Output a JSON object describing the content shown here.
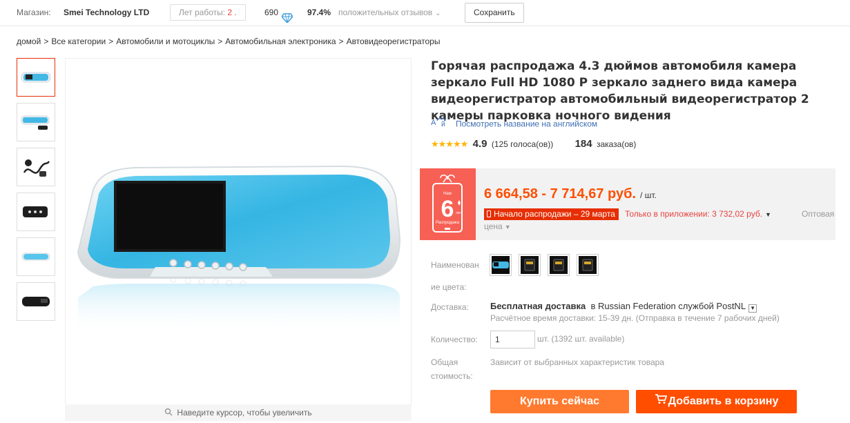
{
  "store": {
    "label": "Магазин:",
    "name": "Smei Technology LTD",
    "years_label": "Лет работы:",
    "years_value": "2 .",
    "score": "690",
    "positive_percent": "97.4%",
    "positive_label": "положительных отзывов",
    "save_label": "Сохранить"
  },
  "breadcrumb": [
    "домой",
    "Все категории",
    "Автомобили и мотоциклы",
    "Автомобильная электроника",
    "Автовидеорегистраторы"
  ],
  "gallery": {
    "thumb_count": 6,
    "zoom_hint": "Наведите курсор, чтобы увеличить"
  },
  "product": {
    "title": "Горячая распродажа 4.3 дюймов автомобиля камера зеркало Full HD 1080 P зеркало заднего вида камера видеорегистратор автомобильный видеорегистратор 2 камеры парковка ночного видения",
    "translate_link": "Посмотреть название на английском",
    "rating_value": "4.9",
    "rating_votes": "(125 голоса(ов))",
    "orders_count": "184",
    "orders_label": "заказа(ов)"
  },
  "promo": {
    "years_num": "6",
    "line1": "Нам",
    "line2": "лет",
    "line3": "Распродажа"
  },
  "pricing": {
    "price_range": "6 664,58 - 7 714,67 руб.",
    "unit": "/ шт.",
    "sale_start": "Начало распродажи – 29 марта",
    "app_only": "Только в приложении: 3 732,02 руб.",
    "wholesale_1": "Оптовая",
    "wholesale_2": "цена"
  },
  "options": {
    "color_label_1": "Наименован",
    "color_label_2": "ие цвета:",
    "shipping_label": "Доставка:",
    "shipping_free": "Бесплатная доставка",
    "shipping_rest": "в Russian Federation службой PostNL",
    "shipping_time": "Расчётное время доставки: 15-39 дн. (Отправка в течение 7 рабочих дней)",
    "qty_label": "Количество:",
    "qty_value": "1",
    "qty_unit": "шт. (1392 шт. available)",
    "total_label_1": "Общая",
    "total_label_2": "стоимость:",
    "total_value": "Зависит от выбранных характеристик товара"
  },
  "actions": {
    "buy_now": "Купить сейчас",
    "add_to_cart": "Добавить в корзину"
  },
  "colors": {
    "accent_orange": "#ff4e00",
    "buy_orange": "#ff7a2f",
    "promo_red": "#f76054",
    "link_blue": "#3d6fb4",
    "star_yellow": "#ffb400"
  }
}
